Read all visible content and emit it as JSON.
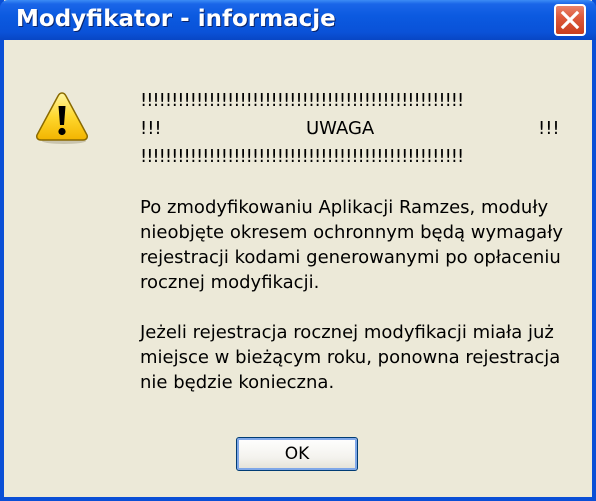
{
  "window": {
    "title": "Modyfikator - informacje"
  },
  "icons": {
    "warning": "warning-icon",
    "close": "close-icon"
  },
  "message": {
    "exclamation_line": "!!!!!!!!!!!!!!!!!!!!!!!!!!!!!!!!!!!!!!!!!!!!!!!!!!!!",
    "marker_left": "!!!",
    "heading": "UWAGA",
    "marker_right": "!!!",
    "paragraph1_lines": [
      "Po zmodyfikowaniu Aplikacji Ramzes, moduły",
      "nieobjęte okresem ochronnym będą wymagały",
      "rejestracji kodami generowanymi po opłaceniu",
      "rocznej modyfikacji."
    ],
    "paragraph2_lines": [
      "Jeżeli rejestracja rocznej modyfikacji miała już",
      "miejsce w bieżącym roku, ponowna rejestracja",
      "nie będzie konieczna."
    ]
  },
  "buttons": {
    "ok_label": "OK"
  },
  "colors": {
    "titlebar": "#0A52D8",
    "window_bg": "#ECE9D8",
    "close": "#DE5A3C"
  }
}
